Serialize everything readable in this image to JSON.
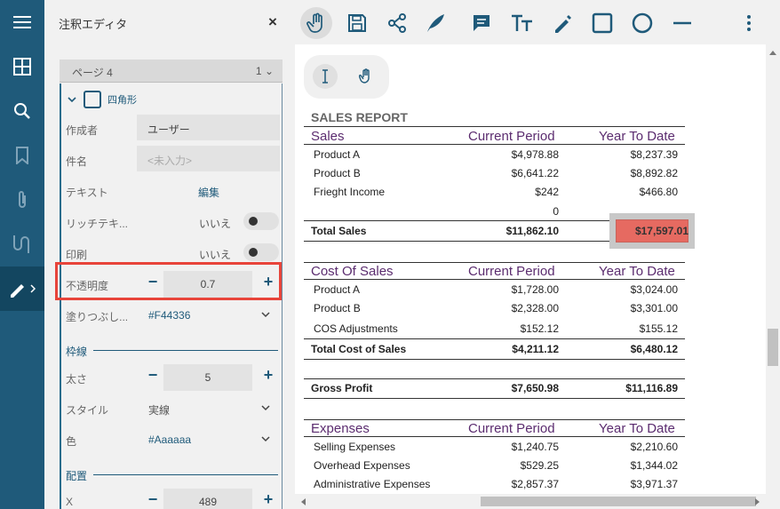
{
  "sidebar_rail": {
    "items": [
      {
        "name": "menu-icon"
      },
      {
        "name": "thumbnails-icon"
      },
      {
        "name": "search-icon"
      },
      {
        "name": "bookmark-icon"
      },
      {
        "name": "attachment-icon"
      },
      {
        "name": "signature-icon"
      },
      {
        "name": "annotation-edit-icon"
      }
    ]
  },
  "panel": {
    "title": "注釈エディタ",
    "close_label": "×",
    "page_selector": {
      "label": "ページ 4",
      "value": "1"
    },
    "annotation_type": "四角形",
    "props": {
      "author_label": "作成者",
      "author_value": "ユーザー",
      "subject_label": "件名",
      "subject_placeholder": "<未入力>",
      "text_label": "テキスト",
      "text_value": "編集",
      "richtext_label": "リッチテキ...",
      "richtext_value": "いいえ",
      "print_label": "印刷",
      "print_value": "いいえ",
      "opacity_label": "不透明度",
      "opacity_value": "0.7",
      "fill_label": "塗りつぶし...",
      "fill_value": "#F44336",
      "border_section": "枠線",
      "width_label": "太さ",
      "width_value": "5",
      "style_label": "スタイル",
      "style_value": "実線",
      "color_label": "色",
      "color_value": "#Aaaaaa",
      "placement_section": "配置",
      "x_label": "X",
      "x_value": "489"
    },
    "stepper_minus": "−",
    "stepper_plus": "+"
  },
  "toolbar": {
    "tools": [
      "pan-tool",
      "save",
      "share",
      "ink",
      "comment",
      "text",
      "pen",
      "rectangle",
      "circle",
      "line",
      "more"
    ]
  },
  "report": {
    "title": "SALES REPORT",
    "col_current": "Current Period",
    "col_ytd": "Year To Date",
    "sales": {
      "header": "Sales",
      "rows": [
        {
          "label": "Product A",
          "current": "$4,978.88",
          "ytd": "$8,237.39"
        },
        {
          "label": "Product B",
          "current": "$6,641.22",
          "ytd": "$8,892.82"
        },
        {
          "label": "Frieght Income",
          "current": "$242",
          "ytd": "$466.80"
        },
        {
          "label": "",
          "current": "0",
          "ytd": ""
        }
      ],
      "total_label": "Total Sales",
      "total_current": "$11,862.10",
      "total_ytd": "$17,597.01"
    },
    "cos": {
      "header": "Cost Of Sales",
      "rows": [
        {
          "label": "Product A",
          "current": "$1,728.00",
          "ytd": "$3,024.00"
        },
        {
          "label": "Product B",
          "current": "$2,328.00",
          "ytd": "$3,301.00"
        },
        {
          "label": "COS Adjustments",
          "current": "$152.12",
          "ytd": "$155.12"
        }
      ],
      "total_label": "Total Cost of Sales",
      "total_current": "$4,211.12",
      "total_ytd": "$6,480.12"
    },
    "gross": {
      "label": "Gross Profit",
      "current": "$7,650.98",
      "ytd": "$11,116.89"
    },
    "expenses": {
      "header": "Expenses",
      "rows": [
        {
          "label": "Selling Expenses",
          "current": "$1,240.75",
          "ytd": "$2,210.60"
        },
        {
          "label": "Overhead Expenses",
          "current": "$529.25",
          "ytd": "$1,344.02"
        },
        {
          "label": "Administrative Expenses",
          "current": "$2,857.37",
          "ytd": "$3,971.37"
        }
      ]
    }
  },
  "colors": {
    "rail": "#1f5a7a",
    "accent": "#1f5a7a",
    "highlight": "#e8443a",
    "annotation_fill": "#F44336"
  }
}
